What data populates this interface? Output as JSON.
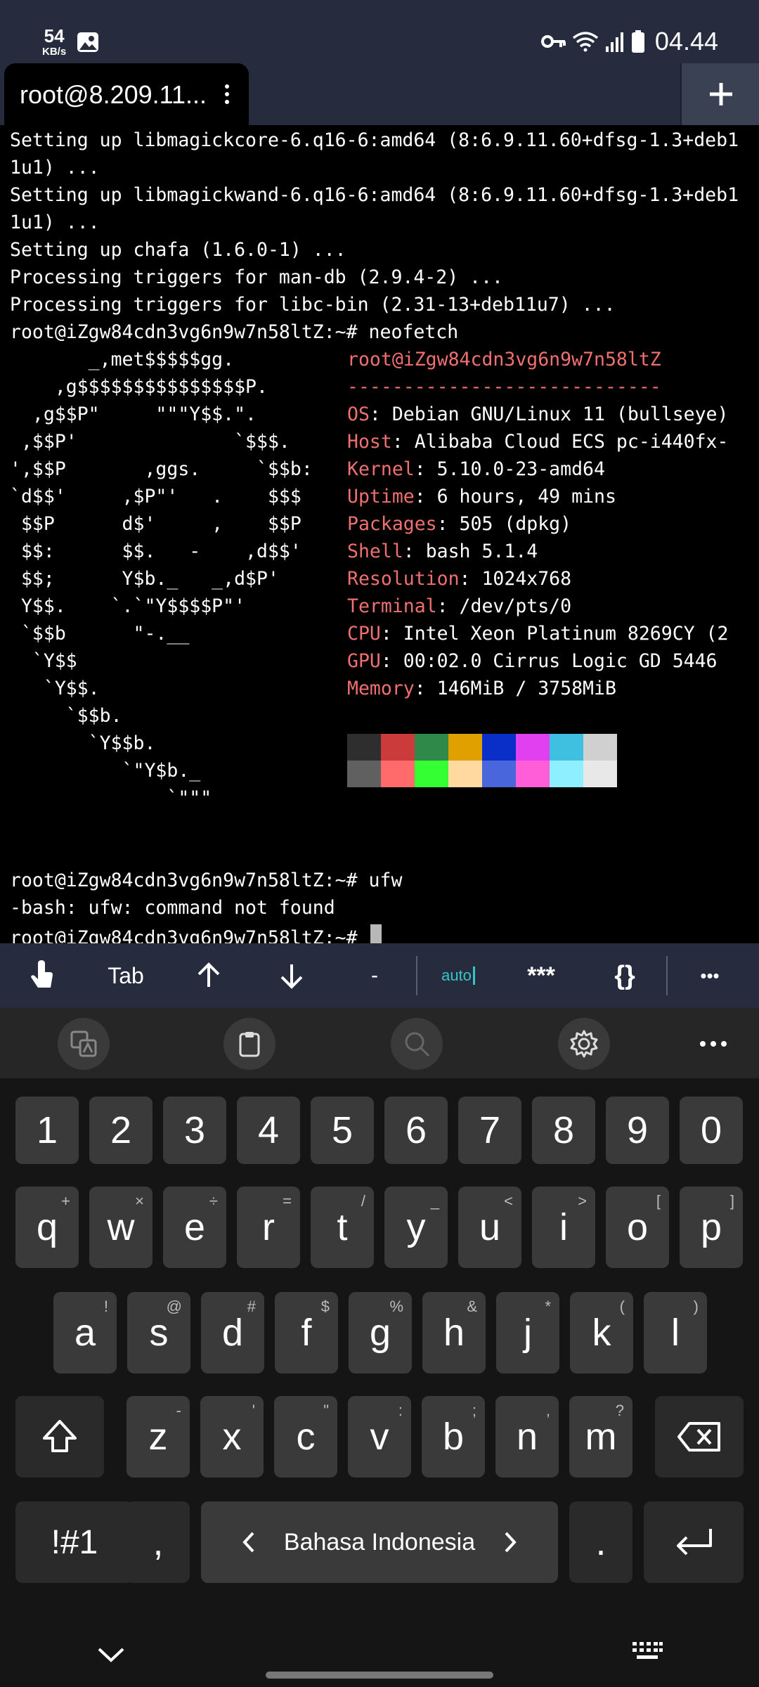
{
  "status_bar": {
    "speed_value": "54",
    "speed_unit": "KB/s",
    "time": "04.44",
    "icons": [
      "gallery-icon",
      "vpn-key-icon",
      "wifi-icon",
      "signal-icon",
      "battery-icon"
    ]
  },
  "tab": {
    "title": "root@8.209.11...",
    "new_tab_label": "+"
  },
  "terminal": {
    "lines": [
      "Setting up libmagickcore-6.q16-6:amd64 (8:6.9.11.60+dfsg-1.3+deb1",
      "1u1) ...",
      "Setting up libmagickwand-6.q16-6:amd64 (8:6.9.11.60+dfsg-1.3+deb1",
      "1u1) ...",
      "Setting up chafa (1.6.0-1) ...",
      "Processing triggers for man-db (2.9.4-2) ...",
      "Processing triggers for libc-bin (2.31-13+deb11u7) ...",
      "root@iZgw84cdn3vg6n9w7n58ltZ:~# neofetch"
    ],
    "logo": [
      "       _,met$$$$$gg.",
      "    ,g$$$$$$$$$$$$$$$P.",
      "  ,g$$P\"     \"\"\"Y$$.\".",
      " ,$$P'              `$$$.",
      "',$$P       ,ggs.     `$$b:",
      "`d$$'     ,$P\"'   .    $$$",
      " $$P      d$'     ,    $$P",
      " $$:      $$.   -    ,d$$'",
      " $$;      Y$b._   _,d$P'",
      " Y$$.    `.`\"Y$$$$P\"'",
      " `$$b      \"-.__",
      "  `Y$$",
      "   `Y$$.",
      "     `$$b.",
      "       `Y$$b.",
      "          `\"Y$b._",
      "              `\"\"\""
    ],
    "info_header": "root@iZgw84cdn3vg6n9w7n58ltZ",
    "info_separator": "----------------------------",
    "info": [
      {
        "key": "OS",
        "value": ": Debian GNU/Linux 11 (bullseye)"
      },
      {
        "key": "Host",
        "value": ": Alibaba Cloud ECS pc-i440fx-"
      },
      {
        "key": "Kernel",
        "value": ": 5.10.0-23-amd64"
      },
      {
        "key": "Uptime",
        "value": ": 6 hours, 49 mins"
      },
      {
        "key": "Packages",
        "value": ": 505 (dpkg)"
      },
      {
        "key": "Shell",
        "value": ": bash 5.1.4"
      },
      {
        "key": "Resolution",
        "value": ": 1024x768"
      },
      {
        "key": "Terminal",
        "value": ": /dev/pts/0"
      },
      {
        "key": "CPU",
        "value": ": Intel Xeon Platinum 8269CY (2"
      },
      {
        "key": "GPU",
        "value": ": 00:02.0 Cirrus Logic GD 5446"
      },
      {
        "key": "Memory",
        "value": ": 146MiB / 3758MiB"
      }
    ],
    "palette_top": [
      "#2e2e2e",
      "#cc3b3b",
      "#2f8a4a",
      "#e0a000",
      "#0a2fc9",
      "#e040f0",
      "#40c0e0",
      "#d0d0d0"
    ],
    "palette_bottom": [
      "#606060",
      "#ff6b6b",
      "#33ff33",
      "#ffd9a0",
      "#4a66dd",
      "#ff5ed8",
      "#8ef0ff",
      "#e8e8e8"
    ],
    "tail": [
      "root@iZgw84cdn3vg6n9w7n58ltZ:~# ufw",
      "-bash: ufw: command not found",
      "root@iZgw84cdn3vg6n9w7n58ltZ:~# "
    ]
  },
  "extra_keys": {
    "tab": "Tab",
    "dash": "-",
    "auto": "auto",
    "stars": "***",
    "braces": "{}",
    "more": "•••"
  },
  "keyboard": {
    "number_row": [
      "1",
      "2",
      "3",
      "4",
      "5",
      "6",
      "7",
      "8",
      "9",
      "0"
    ],
    "row1": [
      {
        "k": "q",
        "s": "+"
      },
      {
        "k": "w",
        "s": "×"
      },
      {
        "k": "e",
        "s": "÷"
      },
      {
        "k": "r",
        "s": "="
      },
      {
        "k": "t",
        "s": "/"
      },
      {
        "k": "y",
        "s": "_"
      },
      {
        "k": "u",
        "s": "<"
      },
      {
        "k": "i",
        "s": ">"
      },
      {
        "k": "o",
        "s": "["
      },
      {
        "k": "p",
        "s": "]"
      }
    ],
    "row2": [
      {
        "k": "a",
        "s": "!"
      },
      {
        "k": "s",
        "s": "@"
      },
      {
        "k": "d",
        "s": "#"
      },
      {
        "k": "f",
        "s": "$"
      },
      {
        "k": "g",
        "s": "%"
      },
      {
        "k": "h",
        "s": "&"
      },
      {
        "k": "j",
        "s": "*"
      },
      {
        "k": "k",
        "s": "("
      },
      {
        "k": "l",
        "s": ")"
      }
    ],
    "row3": [
      {
        "k": "z",
        "s": "-"
      },
      {
        "k": "x",
        "s": "'"
      },
      {
        "k": "c",
        "s": "\""
      },
      {
        "k": "v",
        "s": ":"
      },
      {
        "k": "b",
        "s": ";"
      },
      {
        "k": "n",
        "s": ","
      },
      {
        "k": "m",
        "s": "?"
      }
    ],
    "symbols": "!#1",
    "comma": ",",
    "space_label": "Bahasa Indonesia",
    "period": "."
  }
}
